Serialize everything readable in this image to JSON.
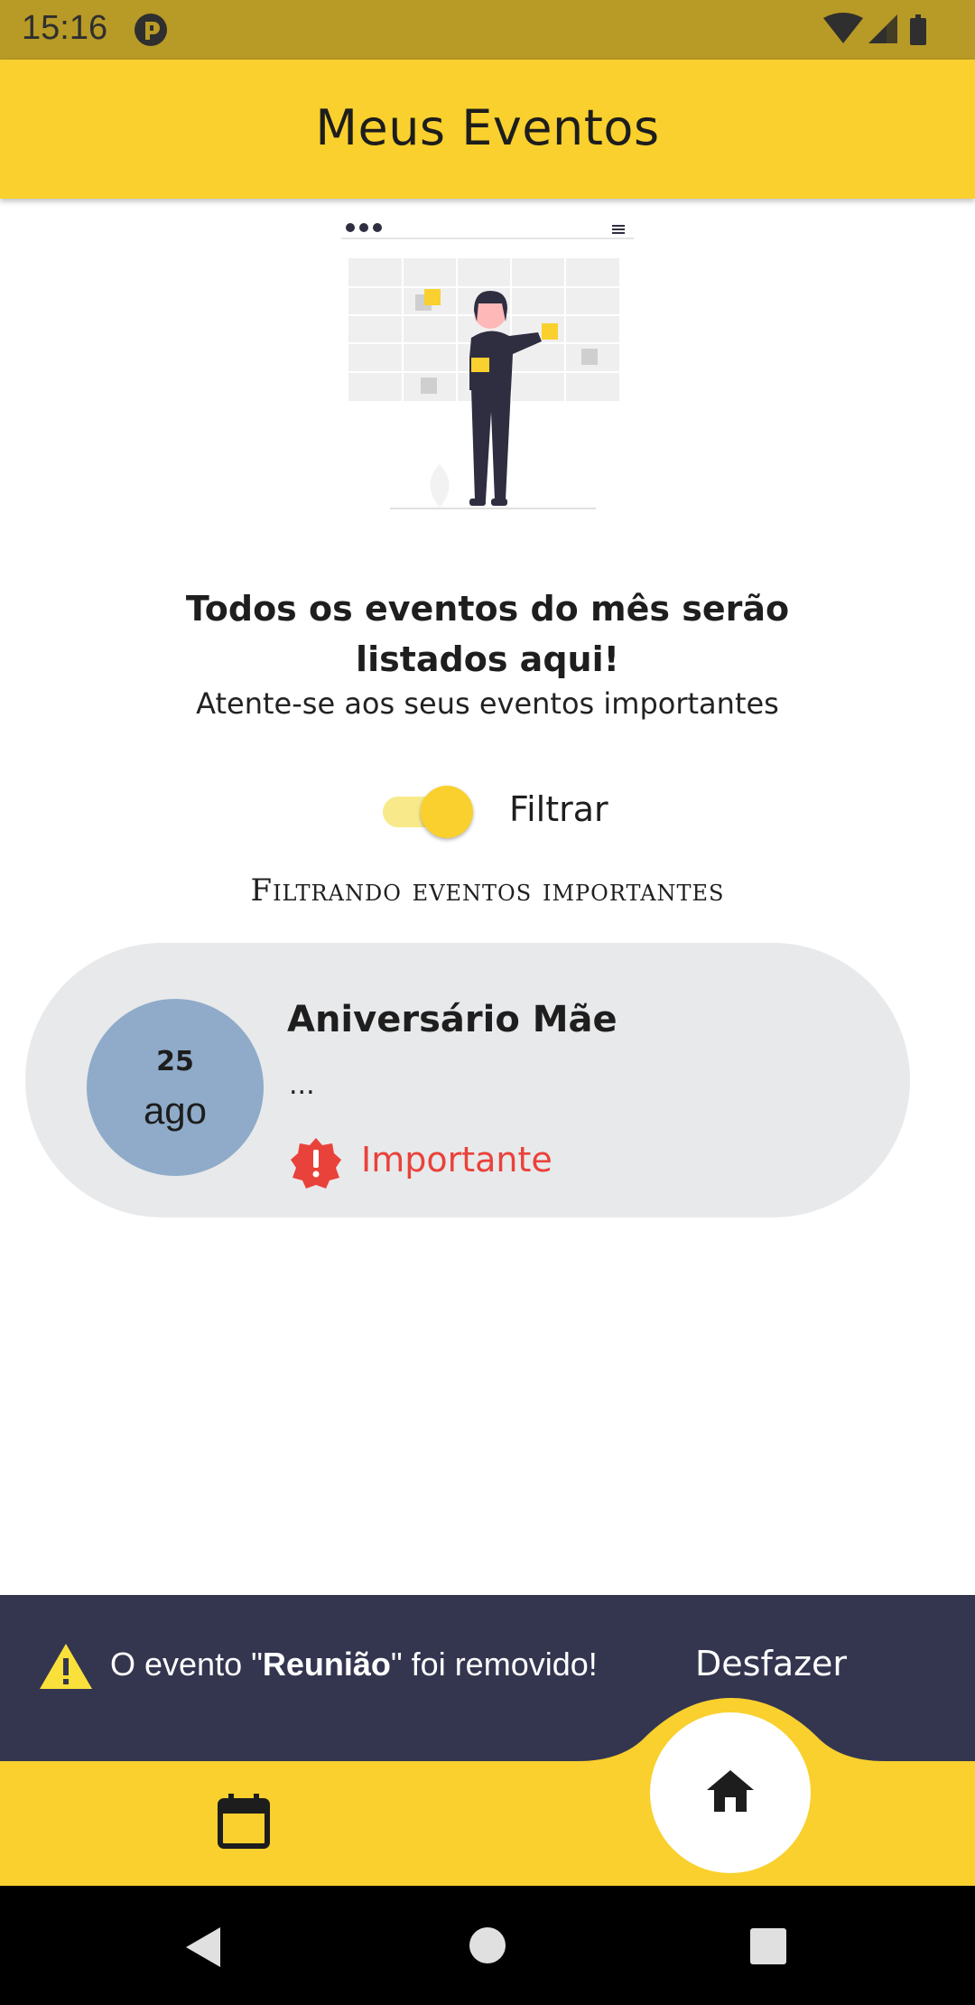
{
  "status_bar": {
    "time": "15:16",
    "icons": [
      "app-notification-icon",
      "wifi-icon",
      "signal-icon",
      "battery-icon"
    ]
  },
  "app_bar": {
    "title": "Meus Eventos",
    "background": "#f9d02d"
  },
  "empty_state": {
    "headline": "Todos os eventos do mês serão listados aqui!",
    "subtitle": "Atente-se aos seus eventos importantes"
  },
  "filter": {
    "toggle_on": true,
    "label": "Filtrar",
    "caption": "Filtrando eventos importantes"
  },
  "events": [
    {
      "day": "25",
      "month": "ago",
      "title": "Aniversário Mãe",
      "description": "...",
      "tag": "Importante",
      "tag_color": "#e9423a",
      "date_circle_color": "#8fabc9"
    }
  ],
  "snackbar": {
    "message_prefix": "O evento \"",
    "message_bold": "Reunião",
    "message_suffix": "\" foi removido!",
    "action": "Desfazer",
    "background": "#343650"
  },
  "bottom_nav": {
    "items": [
      "calendar-icon",
      "home-icon"
    ],
    "active": "home-icon"
  },
  "system_nav": {
    "buttons": [
      "back",
      "home",
      "recents"
    ]
  }
}
